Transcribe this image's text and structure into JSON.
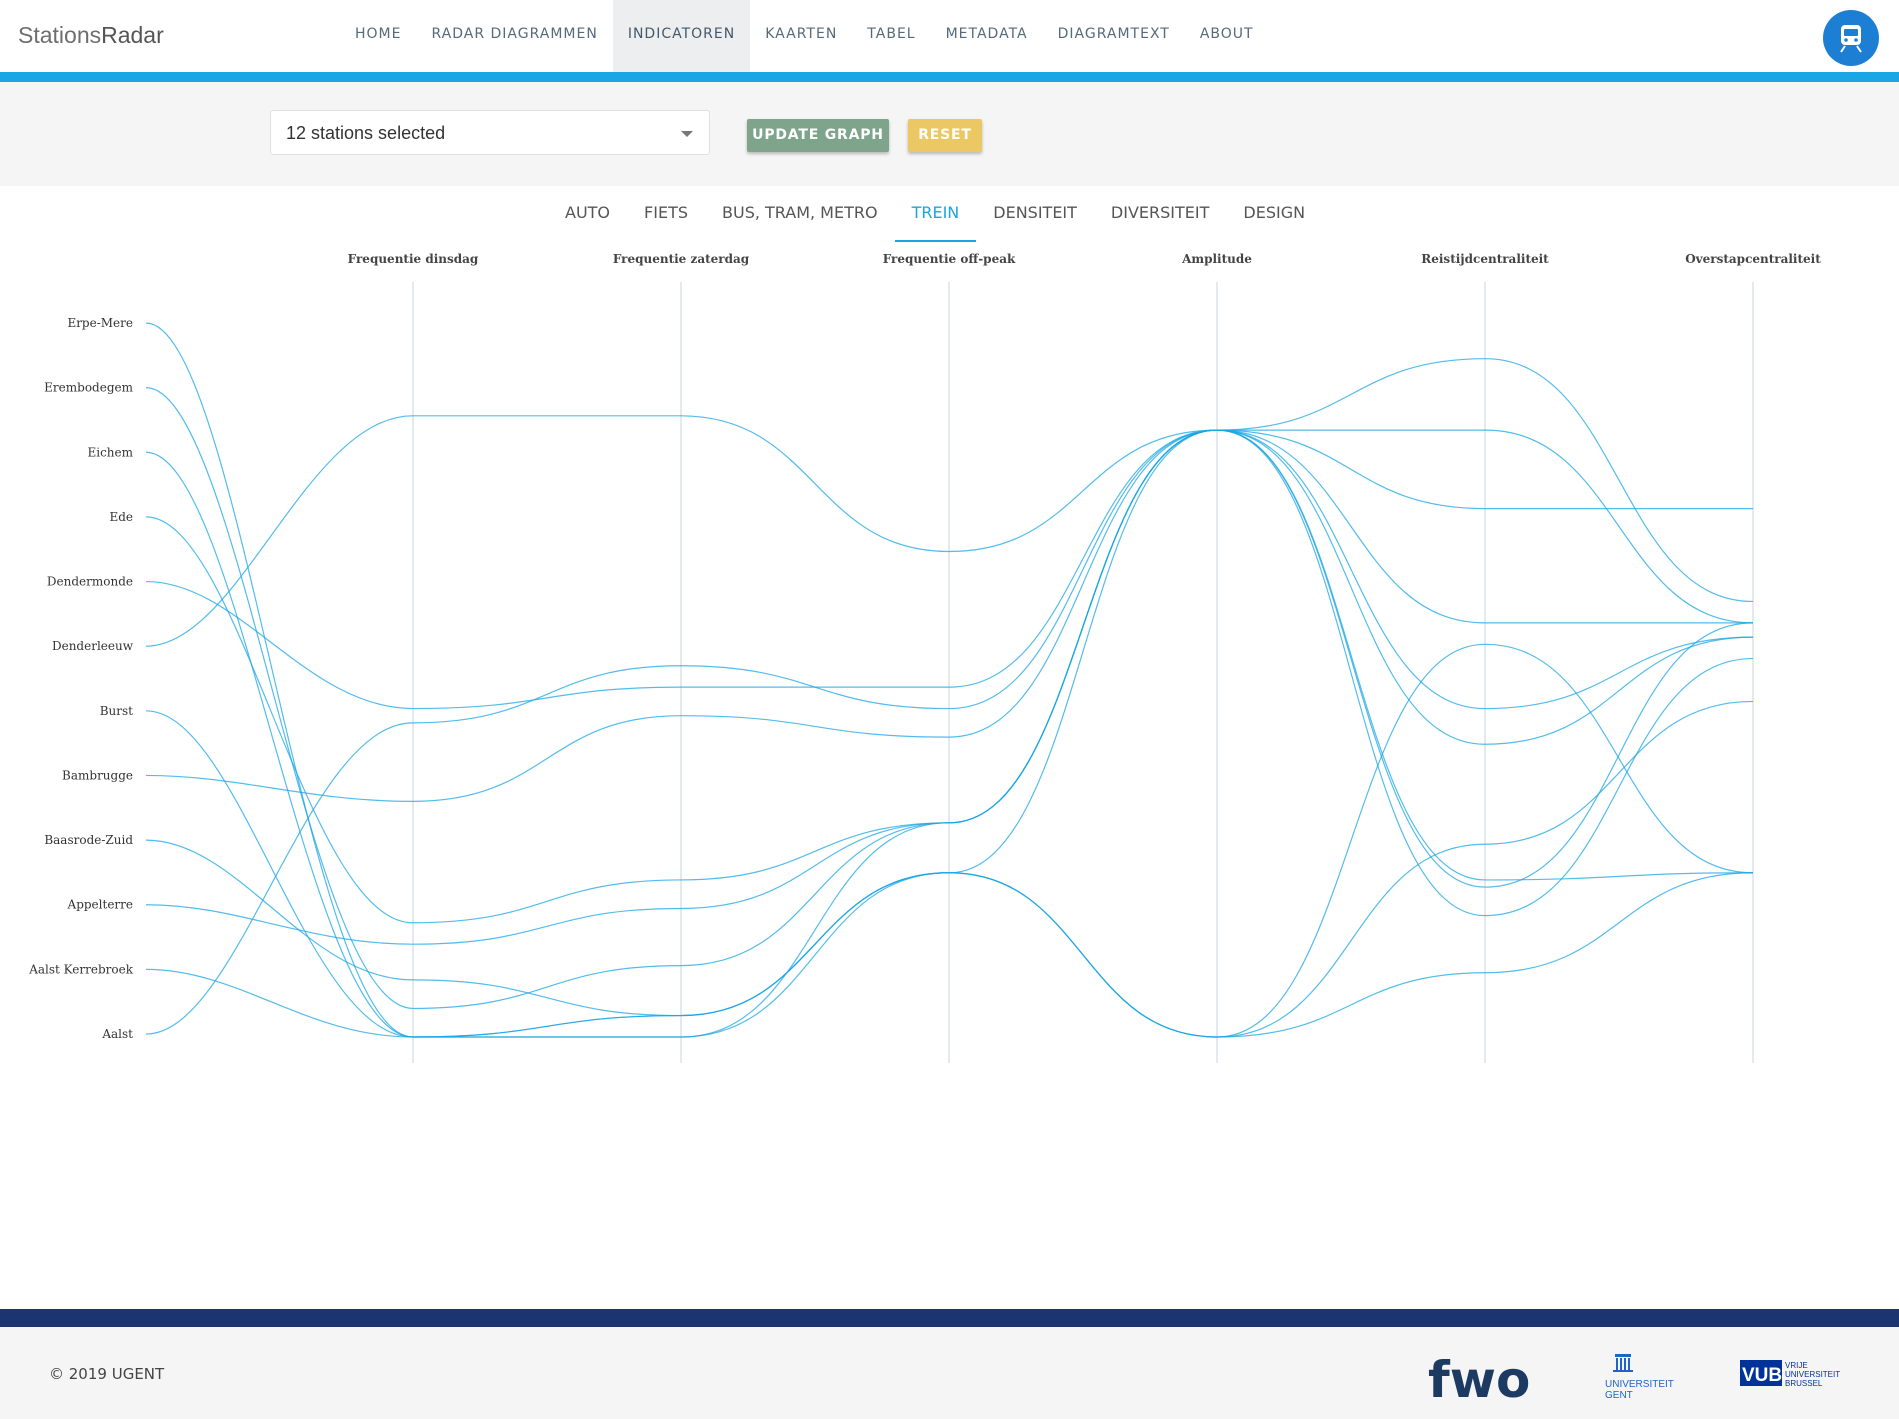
{
  "brand": {
    "part1": "Stations",
    "part2": "Radar"
  },
  "nav": [
    {
      "label": "HOME",
      "active": false
    },
    {
      "label": "RADAR DIAGRAMMEN",
      "active": false
    },
    {
      "label": "INDICATOREN",
      "active": true
    },
    {
      "label": "KAARTEN",
      "active": false
    },
    {
      "label": "TABEL",
      "active": false
    },
    {
      "label": "METADATA",
      "active": false
    },
    {
      "label": "DIAGRAMTEXT",
      "active": false
    },
    {
      "label": "ABOUT",
      "active": false
    }
  ],
  "avatar": {
    "icon": "train-icon"
  },
  "controls": {
    "station_select": "12 stations selected",
    "update_label": "UPDATE GRAPH",
    "reset_label": "RESET"
  },
  "tabs": [
    {
      "label": "AUTO",
      "active": false
    },
    {
      "label": "FIETS",
      "active": false
    },
    {
      "label": "BUS, TRAM, METRO",
      "active": false
    },
    {
      "label": "TREIN",
      "active": true
    },
    {
      "label": "DENSITEIT",
      "active": false
    },
    {
      "label": "DIVERSITEIT",
      "active": false
    },
    {
      "label": "DESIGN",
      "active": false
    }
  ],
  "chart_data": {
    "type": "parallel-coordinates",
    "color": "#1aa6e4",
    "stations": [
      "Erpe-Mere",
      "Erembodegem",
      "Eichem",
      "Ede",
      "Dendermonde",
      "Denderleeuw",
      "Burst",
      "Bambrugge",
      "Baasrode-Zuid",
      "Appelterre",
      "Aalst Kerrebroek",
      "Aalst"
    ],
    "axes": [
      "Frequentie dinsdag",
      "Frequentie zaterdag",
      "Frequentie off-peak",
      "Amplitude",
      "Reistijdcentraliteit",
      "Overstapcentraliteit"
    ],
    "scale_note": "relative scale per axis, 0 = bottom, 1 = top",
    "series": [
      {
        "station": "Erpe-Mere",
        "values": [
          0.0,
          0.03,
          0.23,
          0.85,
          0.22,
          0.23
        ]
      },
      {
        "station": "Erembodegem",
        "values": [
          0.04,
          0.1,
          0.3,
          0.85,
          0.17,
          0.53
        ]
      },
      {
        "station": "Eichem",
        "values": [
          0.0,
          0.0,
          0.3,
          0.85,
          0.21,
          0.58
        ]
      },
      {
        "station": "Ede",
        "values": [
          0.16,
          0.22,
          0.3,
          0.85,
          0.74,
          0.74
        ]
      },
      {
        "station": "Dendermonde",
        "values": [
          0.46,
          0.49,
          0.49,
          0.85,
          0.58,
          0.58
        ]
      },
      {
        "station": "Denderleeuw",
        "values": [
          0.87,
          0.87,
          0.68,
          0.85,
          0.95,
          0.61
        ]
      },
      {
        "station": "Burst",
        "values": [
          0.0,
          0.0,
          0.23,
          0.0,
          0.55,
          0.23
        ]
      },
      {
        "station": "Bambrugge",
        "values": [
          0.33,
          0.45,
          0.42,
          0.85,
          0.85,
          0.58
        ]
      },
      {
        "station": "Baasrode-Zuid",
        "values": [
          0.08,
          0.03,
          0.23,
          0.0,
          0.09,
          0.23
        ]
      },
      {
        "station": "Appelterre",
        "values": [
          0.13,
          0.18,
          0.3,
          0.85,
          0.41,
          0.56
        ]
      },
      {
        "station": "Aalst Kerrebroek",
        "values": [
          0.0,
          0.03,
          0.23,
          0.0,
          0.27,
          0.47
        ]
      },
      {
        "station": "Aalst",
        "values": [
          0.44,
          0.52,
          0.46,
          0.85,
          0.46,
          0.56
        ]
      }
    ]
  },
  "footer": {
    "copyright": "© 2019 UGENT",
    "logos": [
      {
        "name": "fwo-logo",
        "text": "fwo"
      },
      {
        "name": "ugent-logo",
        "line1": "UNIVERSITEIT",
        "line2": "GENT"
      },
      {
        "name": "vub-logo",
        "mark": "VUB",
        "line1": "VRIJE",
        "line2": "UNIVERSITEIT",
        "line3": "BRUSSEL"
      }
    ]
  }
}
